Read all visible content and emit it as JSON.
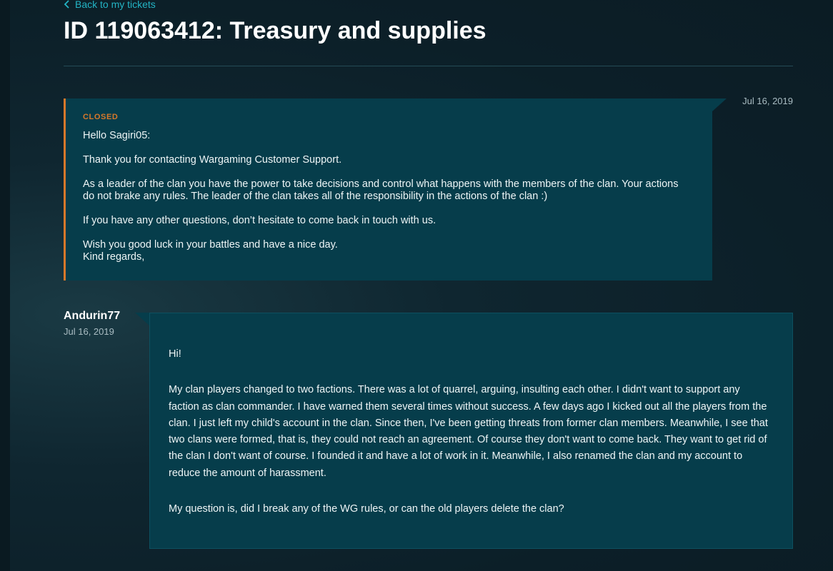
{
  "nav": {
    "back_label": "Back to my tickets"
  },
  "ticket": {
    "title": "ID 119063412: Treasury and supplies"
  },
  "support_reply": {
    "status": "CLOSED",
    "date": "Jul 16, 2019",
    "paragraphs": [
      "Hello Sagiri05:",
      "Thank you for contacting Wargaming Customer Support.",
      "As a leader of the clan you have the power to take decisions and control what happens with the members of the clan.  Your actions do not brake any rules. The leader of the clan takes all of the responsibility in the actions of the clan :)",
      "If you have any other questions, don’t hesitate to come back in touch with us."
    ],
    "closing_line1": "Wish you good luck in your battles and have a nice day.",
    "closing_line2": "Kind regards,"
  },
  "user_message": {
    "author": "Andurin77",
    "date": "Jul 16, 2019",
    "paragraphs": [
      "Hi!",
      "My clan players changed to two factions. There was a lot of quarrel, arguing, insulting each other. I didn't want to support any faction as clan commander. I have warned them several times without success. A few days ago I kicked out all the players from the clan. I just left my child's account in the clan. Since then, I've been getting threats from former clan members. Meanwhile, I see that two clans were formed, that is, they could not reach an agreement. Of course they don't want to come back. They want to get rid of the clan I don't want of course. I founded it and have a lot of work in it. Meanwhile, I also renamed the clan and my account to reduce the amount of harassment.",
      "My question is, did I break any of the WG rules, or can the old players delete the clan?"
    ]
  },
  "colors": {
    "accent_link": "#23b4c5",
    "status_closed": "#d7782a",
    "card_bg": "#063d4b"
  }
}
